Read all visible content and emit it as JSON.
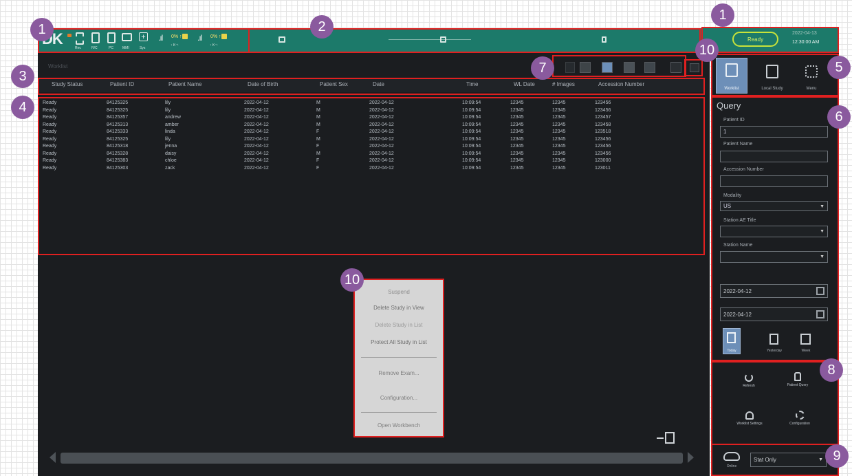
{
  "badges": [
    "1",
    "2",
    "1",
    "10",
    "7",
    "5",
    "3",
    "4",
    "6",
    "10",
    "8",
    "9"
  ],
  "topbar": {
    "logo": "DK",
    "device_labels": [
      "Rec",
      "R/C",
      "PC",
      "MMI",
      "Sys"
    ],
    "signal1": ".ıl",
    "signal2": ".ıl",
    "wifi_label1": "0% ↑",
    "wifi_label2": "0% ↑",
    "net_label1": "↑ K⁻¹",
    "net_label2": "↑ K⁻¹",
    "status_pill": "Ready",
    "date": "2022-04-13",
    "time": "12:30:00 AM"
  },
  "main": {
    "worklist_title": "Worklist",
    "columns": [
      "Study Status",
      "Patient ID",
      "Patient Name",
      "Date of Birth",
      "Patient Sex",
      "Date",
      "Time",
      "WL Date",
      "# Images",
      "Accession Number"
    ],
    "rows": [
      [
        "Ready",
        "84125325",
        "lily",
        "2022-04-12",
        "M",
        "2022-04-12",
        "10:09:54",
        "12345",
        "12345",
        "123456"
      ],
      [
        "Ready",
        "84125325",
        "lily",
        "2022-04-12",
        "M",
        "2022-04-12",
        "10:09:54",
        "12345",
        "12345",
        "123456"
      ],
      [
        "Ready",
        "84125357",
        "andrew",
        "2022-04-12",
        "M",
        "2022-04-12",
        "10:09:54",
        "12345",
        "12345",
        "123457"
      ],
      [
        "Ready",
        "84125313",
        "amber",
        "2022-04-12",
        "M",
        "2022-04-12",
        "10:09:54",
        "12345",
        "12345",
        "123458"
      ],
      [
        "Ready",
        "84125333",
        "linda",
        "2022-04-12",
        "F",
        "2022-04-12",
        "10:09:54",
        "12345",
        "12345",
        "123518"
      ],
      [
        "Ready",
        "84125325",
        "lily",
        "2022-04-12",
        "M",
        "2022-04-12",
        "10:09:54",
        "12345",
        "12345",
        "123456"
      ],
      [
        "Ready",
        "84125318",
        "jenna",
        "2022-04-12",
        "F",
        "2022-04-12",
        "10:09:54",
        "12345",
        "12345",
        "123456"
      ],
      [
        "Ready",
        "84125328",
        "daisy",
        "2022-04-12",
        "M",
        "2022-04-12",
        "10:09:54",
        "12345",
        "12345",
        "123456"
      ],
      [
        "Ready",
        "84125383",
        "chloe",
        "2022-04-12",
        "F",
        "2022-04-12",
        "10:09:54",
        "12345",
        "12345",
        "123000"
      ],
      [
        "Ready",
        "84125303",
        "zack",
        "2022-04-12",
        "F",
        "2022-04-12",
        "10:09:54",
        "12345",
        "12345",
        "123011"
      ]
    ]
  },
  "context_menu": {
    "items": [
      "Suspend",
      "Delete Study in View",
      "Delete Study in List",
      "Protect All Study in List",
      "Remove Exam...",
      "Configuration...",
      "Open Workbench"
    ]
  },
  "right": {
    "mode_labels": [
      "Worklist",
      "Local Study",
      "Menu"
    ],
    "query_title": "Query",
    "patient_id_label": "Patient ID",
    "patient_id_value": "1",
    "patient_name_label": "Patient Name",
    "accession_label": "Accession Number",
    "modality_label": "Modality",
    "modality_value": "US",
    "station_ae_label": "Station AE Title",
    "station_name_label": "Station Name",
    "date_from": "2022-04-12",
    "date_to": "2022-04-12",
    "search_labels": [
      "Today",
      "Yesterday",
      "Week"
    ],
    "tools": [
      "Refresh",
      "Patient Query",
      "Worklist Settings",
      "Configuration"
    ],
    "cloud_label": "Online",
    "status_value": "Stat Only"
  }
}
